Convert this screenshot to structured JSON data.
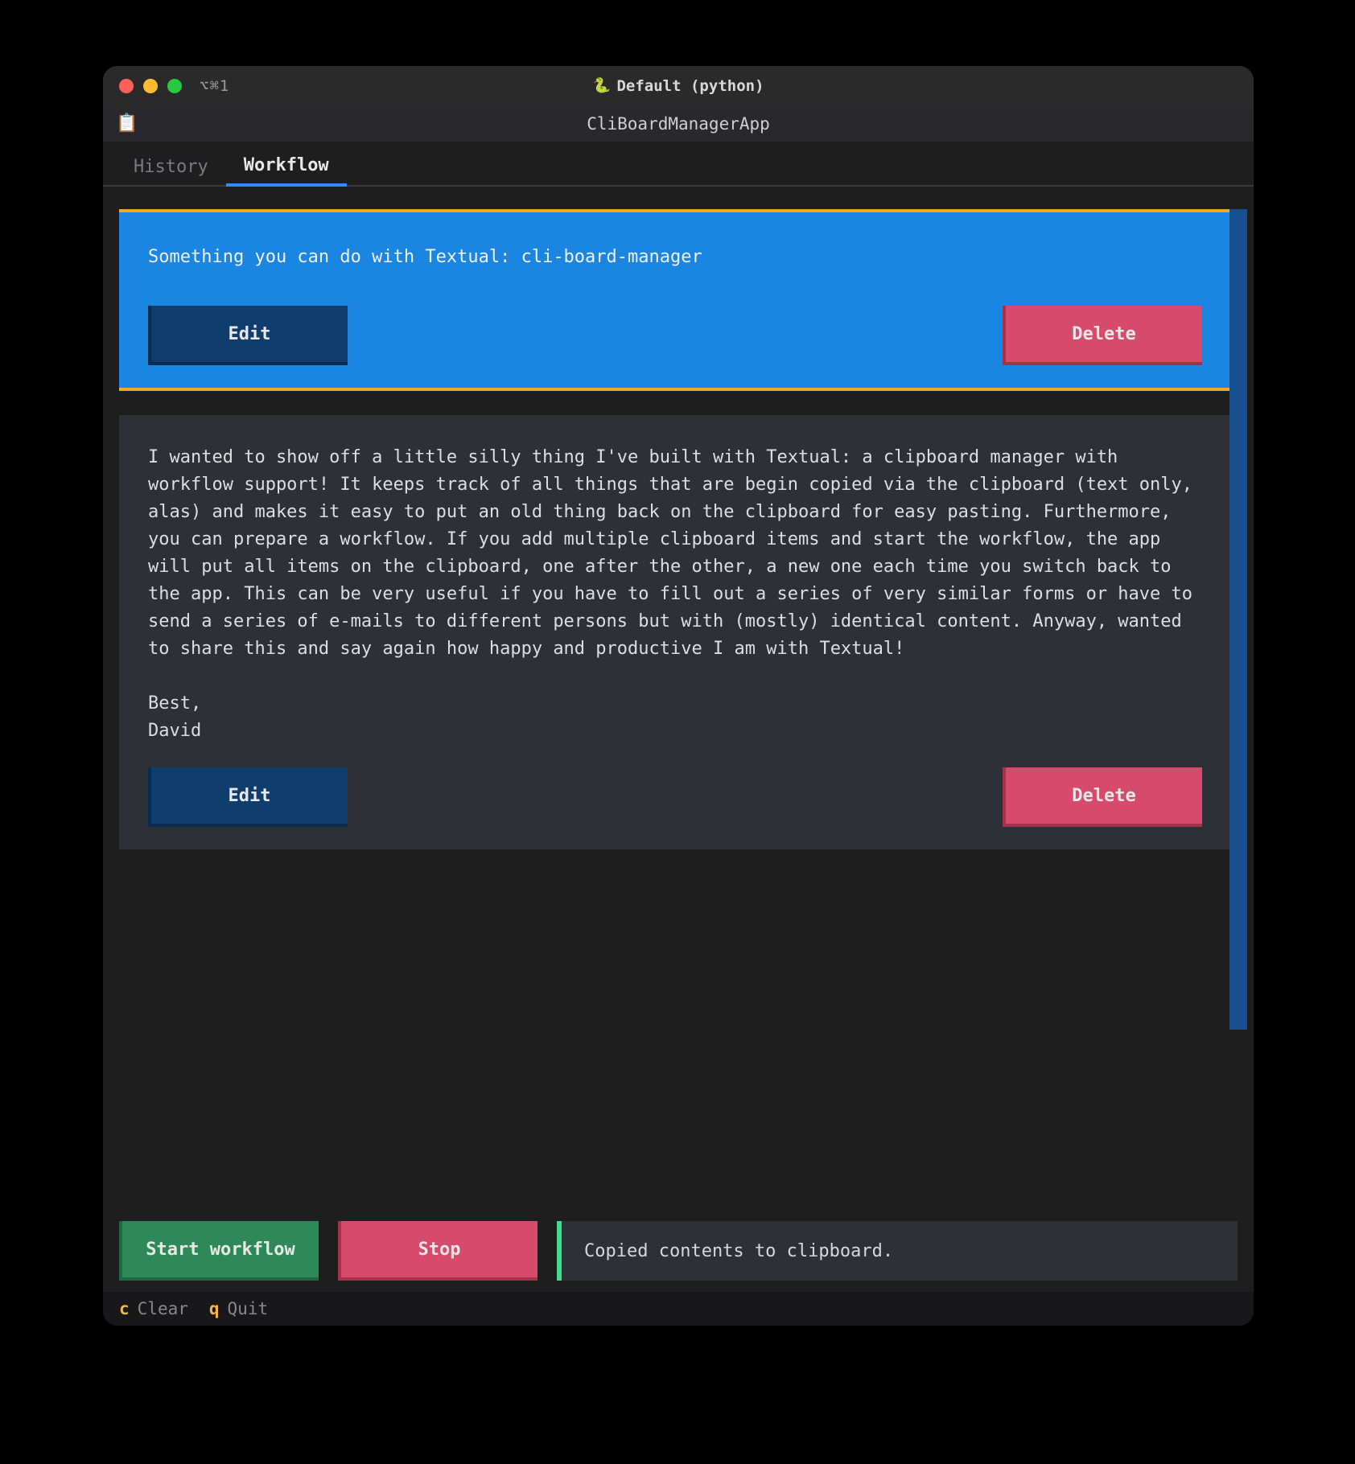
{
  "mac_titlebar": {
    "left_hint": "⌥⌘1",
    "center_title": "Default (python)"
  },
  "app_header": {
    "title": "CliBoardManagerApp"
  },
  "tabs": {
    "history": "History",
    "workflow": "Workflow"
  },
  "cards": [
    {
      "text": "Something you can do with Textual: cli-board-manager",
      "edit_label": "Edit",
      "delete_label": "Delete",
      "selected": true
    },
    {
      "text": "I wanted to show off a little silly thing I've built with Textual: a clipboard manager with workflow support! It keeps track of all things that are begin copied via the clipboard (text only, alas) and makes it easy to put an old thing back on the clipboard for easy pasting. Furthermore, you can prepare a workflow. If you add multiple clipboard items and start the workflow, the app will put all items on the clipboard, one after the other, a new one each time you switch back to the app. This can be very useful if you have to fill out a series of very similar forms or have to send a series of e-mails to different persons but with (mostly) identical content. Anyway, wanted to share this and say again how happy and productive I am with Textual!\n\nBest,\nDavid",
      "edit_label": "Edit",
      "delete_label": "Delete",
      "selected": false
    }
  ],
  "actions": {
    "start_label": "Start workflow",
    "stop_label": "Stop",
    "status": "Copied contents to clipboard."
  },
  "footer_keys": {
    "clear_key": "c",
    "clear_label": "Clear",
    "quit_key": "q",
    "quit_label": "Quit"
  },
  "icons": {
    "python": "🐍",
    "clipboard": "📋"
  }
}
